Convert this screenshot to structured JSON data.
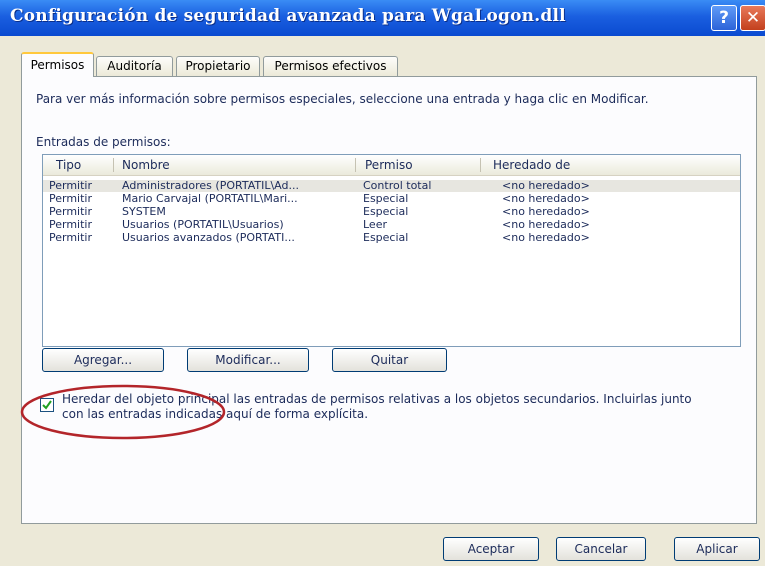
{
  "window": {
    "title": "Configuración de seguridad avanzada para WgaLogon.dll"
  },
  "tabs": [
    {
      "label": "Permisos",
      "active": true
    },
    {
      "label": "Auditoría"
    },
    {
      "label": "Propietario"
    },
    {
      "label": "Permisos efectivos"
    }
  ],
  "info_text": "Para ver más información sobre permisos especiales, seleccione una entrada y haga clic en Modificar.",
  "entries_label": "Entradas de permisos:",
  "table": {
    "columns": [
      "Tipo",
      "Nombre",
      "Permiso",
      "Heredado de"
    ],
    "rows": [
      [
        "Permitir",
        "Administradores (PORTATIL\\Ad...",
        "Control total",
        "<no heredado>"
      ],
      [
        "Permitir",
        "Mario Carvajal (PORTATIL\\Mari...",
        "Especial",
        "<no heredado>"
      ],
      [
        "Permitir",
        "SYSTEM",
        "Especial",
        "<no heredado>"
      ],
      [
        "Permitir",
        "Usuarios (PORTATIL\\Usuarios)",
        "Leer",
        "<no heredado>"
      ],
      [
        "Permitir",
        "Usuarios avanzados (PORTATI...",
        "Especial",
        "<no heredado>"
      ]
    ]
  },
  "buttons": {
    "add": "Agregar...",
    "modify": "Modificar...",
    "remove": "Quitar",
    "accept": "Aceptar",
    "cancel": "Cancelar",
    "apply": "Aplicar"
  },
  "inherit_checkbox": {
    "checked": true,
    "line1": "Heredar del objeto principal las entradas de permisos relativas a los objetos secundarios. Incluirlas junto",
    "line2": "con las entradas indicadas aquí de forma explícita."
  },
  "colors": {
    "title_bar": "#0a4ad0",
    "annotation_circle": "#b3252a",
    "active_tab_highlight": "#ffc83c"
  }
}
